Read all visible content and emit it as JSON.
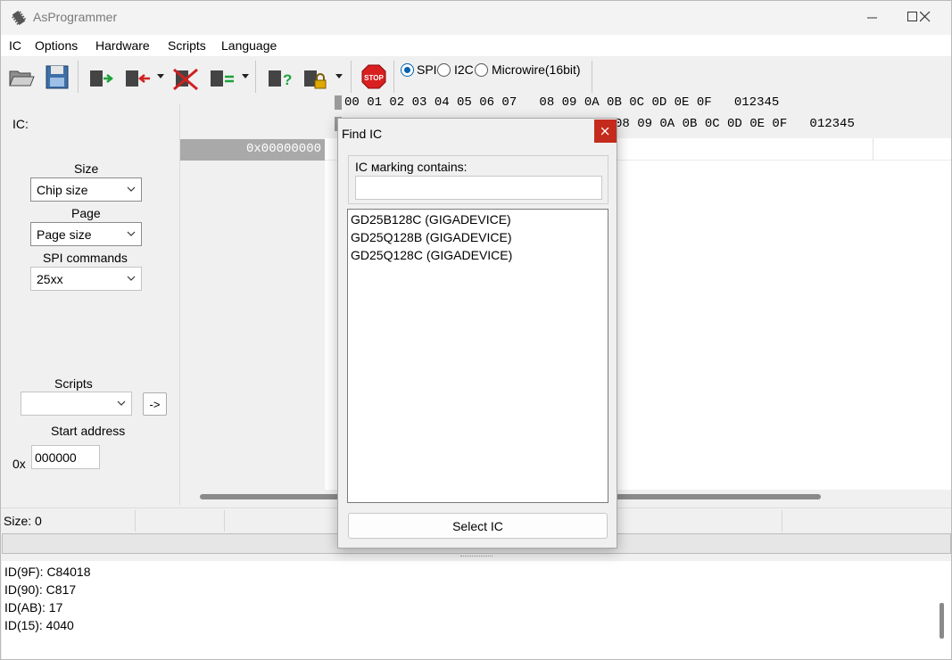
{
  "window": {
    "title": "AsProgrammer"
  },
  "menu": [
    "IC",
    "Options",
    "Hardware",
    "Scripts",
    "Language"
  ],
  "toolbar": {
    "icons": [
      "open-file-icon",
      "save-icon",
      "read-chip-icon",
      "write-chip-icon",
      "erase-chip-icon",
      "verify-chip-icon",
      "read-id-icon",
      "lock-icon",
      "stop-icon"
    ],
    "protocols": [
      {
        "label": "SPI",
        "checked": true
      },
      {
        "label": "I2C",
        "checked": false
      },
      {
        "label": "Microwire(16bit)",
        "checked": false
      }
    ]
  },
  "left_panel": {
    "ic_label": "IC:",
    "size_label": "Size",
    "size_value": "Chip size",
    "page_label": "Page",
    "page_value": "Page size",
    "spi_commands_label": "SPI commands",
    "spi_commands_value": "25xx",
    "scripts_label": "Scripts",
    "scripts_value": "",
    "run_script_label": "->",
    "start_address_label": "Start address",
    "start_address_prefix": "0x",
    "start_address_value": "000000"
  },
  "hex": {
    "header_row1": "00 01 02 03 04 05 06 07   08 09 0A 0B 0C 0D 0E 0F   012345",
    "header_row2": "08 09 0A 0B 0C 0D 0E 0F   012345",
    "address": "0x00000000"
  },
  "status": {
    "size_text": "Size: 0"
  },
  "log": [
    "ID(9F): C84018",
    "ID(90): C817",
    "ID(AB): 17",
    "ID(15): 4040"
  ],
  "dialog": {
    "title": "Find IC",
    "search_label": "IC мarking contains:",
    "search_value": "",
    "results": [
      "GD25B128C (GIGADEVICE)",
      "GD25Q128B (GIGADEVICE)",
      "GD25Q128C (GIGADEVICE)"
    ],
    "select_button": "Select IC"
  }
}
